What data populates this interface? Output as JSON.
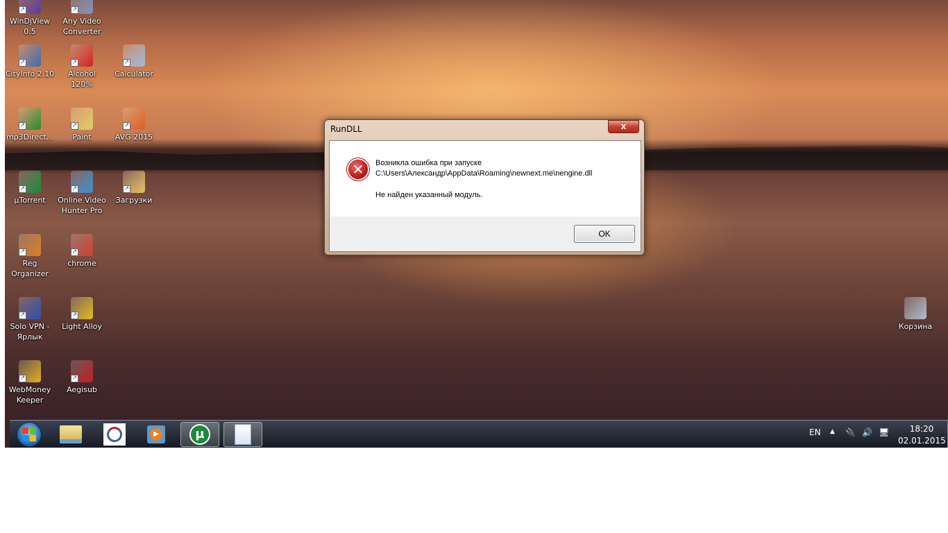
{
  "desktop_icons": [
    {
      "label": "WinDjView 0.5",
      "color": "#5a3aa0"
    },
    {
      "label": "Any Video Converter",
      "color": "#8090c0"
    },
    {
      "label": "CityInfo 2.10",
      "color": "#3a6ab0"
    },
    {
      "label": "Alcohol 120%",
      "color": "#d02020"
    },
    {
      "label": "Calculator",
      "color": "#a0b8d8"
    },
    {
      "label": "mp3Direct...",
      "color": "#2a8a2a"
    },
    {
      "label": "Paint",
      "color": "#e0d060"
    },
    {
      "label": "AVG 2015",
      "color": "#e06020"
    },
    {
      "label": "µTorrent",
      "color": "#1a8a3a"
    },
    {
      "label": "Online Video Hunter Pro",
      "color": "#3a90d0"
    },
    {
      "label": "Загрузки",
      "color": "#e8c060"
    },
    {
      "label": "Reg Organizer",
      "color": "#e08020"
    },
    {
      "label": "chrome",
      "color": "#d04030"
    },
    {
      "label": "Solo VPN - Ярлык",
      "color": "#3050b0"
    },
    {
      "label": "Light Alloy",
      "color": "#e0c020"
    },
    {
      "label": "WebMoney Keeper",
      "color": "#e0b020"
    },
    {
      "label": "Aegisub",
      "color": "#c02020"
    },
    {
      "label": "Корзина",
      "color": "#b0c0d0"
    }
  ],
  "dialog": {
    "title": "RunDLL",
    "close_label": "x",
    "icon": "error-icon",
    "message_line1": "Возникла ошибка при запуске",
    "message_line2": "C:\\Users\\Александр\\AppData\\Roaming\\newnext.me\\nengine.dll",
    "message_line3": "Не найден указанный модуль.",
    "ok_label": "OK"
  },
  "taskbar": {
    "items": [
      "start-button",
      "explorer",
      "app-circle",
      "media-player",
      "utorrent",
      "document"
    ],
    "language": "EN",
    "time": "18:20",
    "date": "02.01.2015"
  }
}
